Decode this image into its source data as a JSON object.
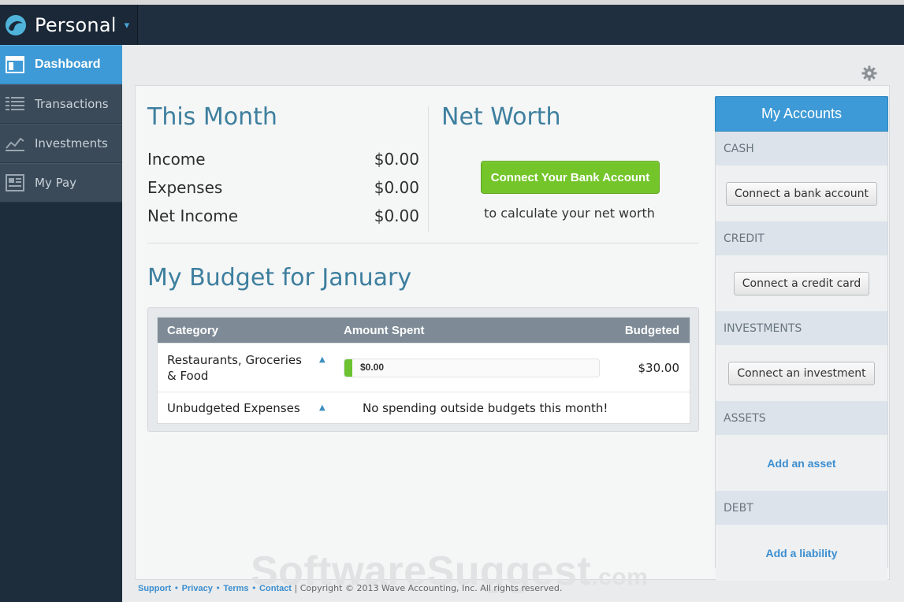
{
  "header": {
    "account_switcher": "Personal",
    "caret": "▾"
  },
  "sidebar": {
    "items": [
      {
        "label": "Dashboard",
        "icon": "dashboard-icon",
        "active": true
      },
      {
        "label": "Transactions",
        "icon": "list-icon",
        "active": false
      },
      {
        "label": "Investments",
        "icon": "line-chart-icon",
        "active": false
      },
      {
        "label": "My Pay",
        "icon": "paystub-icon",
        "active": false
      }
    ]
  },
  "this_month": {
    "title": "This Month",
    "rows": [
      {
        "label": "Income",
        "value": "$0.00"
      },
      {
        "label": "Expenses",
        "value": "$0.00"
      },
      {
        "label": "Net Income",
        "value": "$0.00"
      }
    ]
  },
  "net_worth": {
    "title": "Net Worth",
    "button": "Connect Your Bank Account",
    "caption": "to calculate your net worth"
  },
  "budget": {
    "title": "My Budget for January",
    "columns": [
      "Category",
      "Amount Spent",
      "Budgeted"
    ],
    "rows": [
      {
        "category": "Restaurants, Groceries & Food",
        "spent": "$0.00",
        "spent_fraction": 0.03,
        "budgeted": "$30.00"
      },
      {
        "category": "Unbudgeted Expenses",
        "note": "No spending outside budgets this month!"
      }
    ],
    "expand_glyph": "▲"
  },
  "accounts": {
    "title": "My Accounts",
    "sections": [
      {
        "label": "CASH",
        "action": "Connect a bank account",
        "kind": "button"
      },
      {
        "label": "CREDIT",
        "action": "Connect a credit card",
        "kind": "button"
      },
      {
        "label": "INVESTMENTS",
        "action": "Connect an investment",
        "kind": "button"
      },
      {
        "label": "ASSETS",
        "action": "Add an asset",
        "kind": "link"
      },
      {
        "label": "DEBT",
        "action": "Add a liability",
        "kind": "link"
      }
    ]
  },
  "watermark": {
    "main": "SoftwareSuggest",
    "tld": ".com"
  },
  "footer": {
    "links": [
      "Support",
      "Privacy",
      "Terms",
      "Contact"
    ],
    "bullet": "•",
    "divider": "|",
    "copyright": "Copyright © 2013 Wave Accounting, Inc. All rights reserved."
  },
  "colors": {
    "accent": "#3d9ad6",
    "success": "#74c52a",
    "heading": "#3d7f9e",
    "sidebar": "#1e2d3c"
  }
}
